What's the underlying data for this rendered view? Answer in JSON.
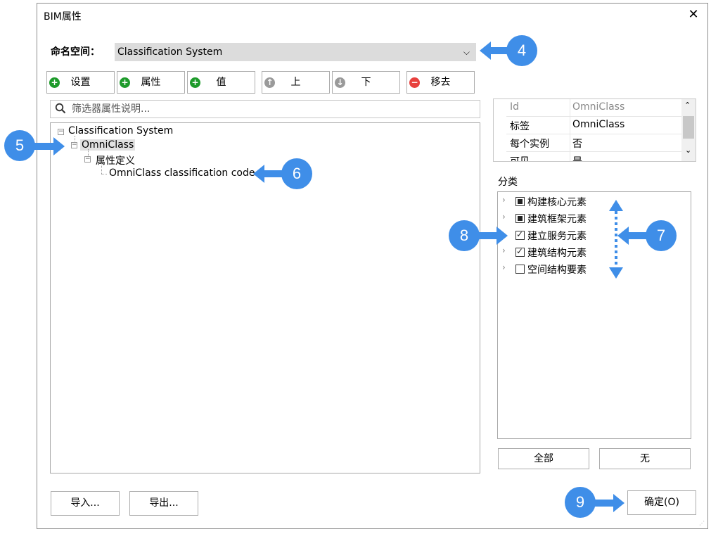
{
  "window": {
    "title": "BIM属性",
    "close_glyph": "✕"
  },
  "namespace": {
    "label": "命名空间：",
    "value": "Classification System"
  },
  "toolbar": {
    "set": "设置",
    "property": "属性",
    "value": "值",
    "up": "上",
    "down": "下",
    "remove": "移去"
  },
  "filter": {
    "placeholder": "筛选器属性说明..."
  },
  "tree": {
    "root": "Classification System",
    "child": "OmniClass",
    "grandchild": "属性定义",
    "leaf": "OmniClass classification code"
  },
  "props": [
    {
      "key": "Id",
      "value": "OmniClass"
    },
    {
      "key": "标签",
      "value": "OmniClass"
    },
    {
      "key": "每个实例",
      "value": "否"
    },
    {
      "key": "可见",
      "value": "是"
    }
  ],
  "category": {
    "label": "分类",
    "items": [
      {
        "label": "构建核心元素",
        "state": "partial"
      },
      {
        "label": "建筑框架元素",
        "state": "partial"
      },
      {
        "label": "建立服务元素",
        "state": "checked"
      },
      {
        "label": "建筑结构元素",
        "state": "checked"
      },
      {
        "label": "空间结构要素",
        "state": "unchecked"
      }
    ],
    "all_button": "全部",
    "none_button": "无"
  },
  "footer": {
    "import": "导入...",
    "export": "导出...",
    "ok": "确定(O)"
  },
  "annotations": {
    "n4": "4",
    "n5": "5",
    "n6": "6",
    "n7": "7",
    "n8": "8",
    "n9": "9"
  },
  "colors": {
    "annotation_blue": "#3f8ee8",
    "add_green": "#1e9b2b",
    "remove_red": "#e8413e"
  }
}
